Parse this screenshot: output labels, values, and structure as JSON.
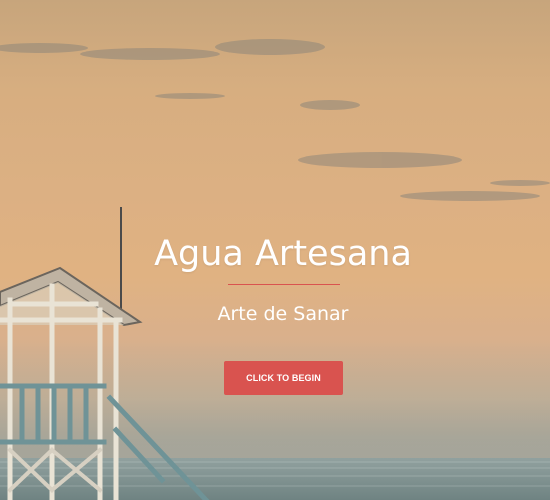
{
  "hero": {
    "title": "Agua Artesana",
    "subtitle": "Arte de Sanar",
    "cta_label": "CLICK TO BEGIN"
  },
  "colors": {
    "accent": "#d9534f",
    "text": "#ffffff",
    "sky_top": "#c7a57c",
    "sky_mid": "#e0b282",
    "sea": "#7f9190",
    "tower": "#6e8d93"
  }
}
